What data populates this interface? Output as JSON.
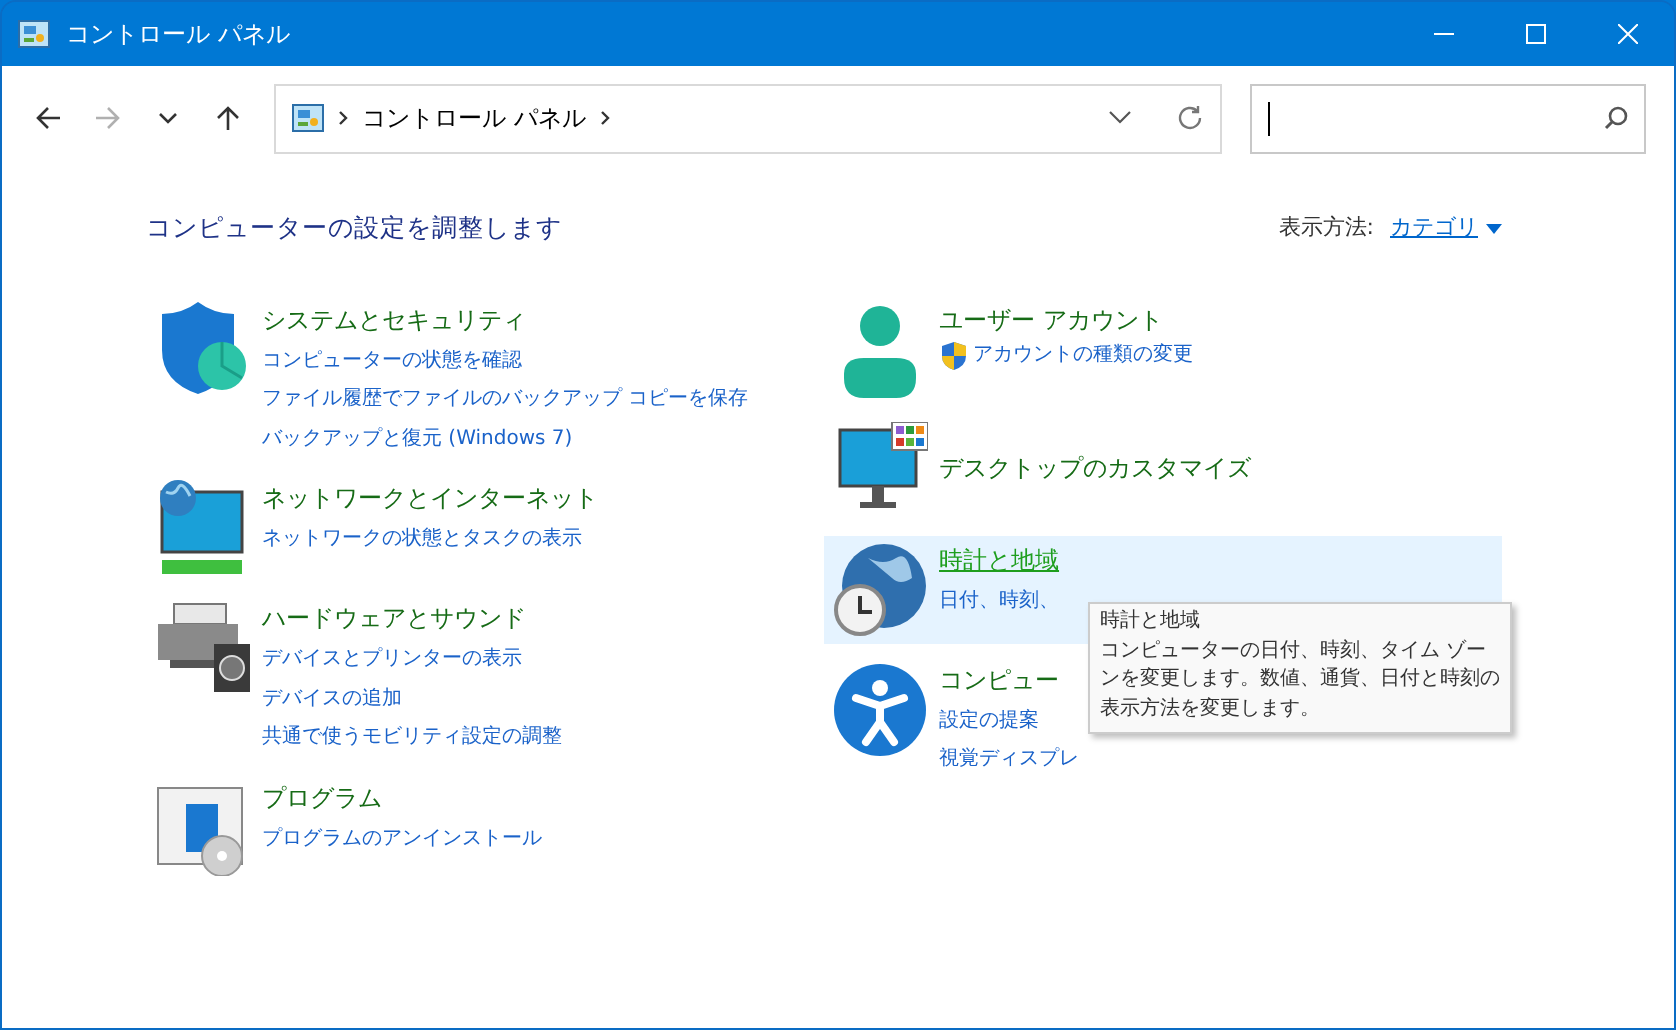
{
  "window": {
    "title": "コントロール パネル"
  },
  "nav_buttons": [
    {
      "kind": "back",
      "disabled": false
    },
    {
      "kind": "forward",
      "disabled": true
    },
    {
      "kind": "recent",
      "disabled": false
    },
    {
      "kind": "up",
      "disabled": false
    }
  ],
  "address_bar": {
    "breadcrumb": "コントロール パネル"
  },
  "search": {
    "focused": true
  },
  "heading": "コンピューターの設定を調整します",
  "view_by": {
    "label": "表示方法:",
    "value": "カテゴリ"
  },
  "columns": [
    {
      "categories": [
        {
          "title": "システムとセキュリティ",
          "hovered": false,
          "links": [
            {
              "text": "コンピューターの状態を確認",
              "shield": false
            },
            {
              "text": "ファイル履歴でファイルのバックアップ コピーを保存",
              "shield": false
            },
            {
              "text": "バックアップと復元 (Windows 7)",
              "shield": false
            }
          ]
        },
        {
          "title": "ネットワークとインターネット",
          "hovered": false,
          "links": [
            {
              "text": "ネットワークの状態とタスクの表示",
              "shield": false
            }
          ]
        },
        {
          "title": "ハードウェアとサウンド",
          "hovered": false,
          "links": [
            {
              "text": "デバイスとプリンターの表示",
              "shield": false
            },
            {
              "text": "デバイスの追加",
              "shield": false
            },
            {
              "text": "共通で使うモビリティ設定の調整",
              "shield": false
            }
          ]
        },
        {
          "title": "プログラム",
          "hovered": false,
          "links": [
            {
              "text": "プログラムのアンインストール",
              "shield": false
            }
          ]
        }
      ]
    },
    {
      "categories": [
        {
          "title": "ユーザー アカウント",
          "hovered": false,
          "links": [
            {
              "text": "アカウントの種類の変更",
              "shield": true
            }
          ]
        },
        {
          "title": "デスクトップのカスタマイズ",
          "hovered": false
        },
        {
          "title": "時計と地域",
          "hovered": true,
          "links": [
            {
              "text": "日付、時刻、",
              "shield": false
            }
          ]
        },
        {
          "title": "コンピュー",
          "hovered": false,
          "links": [
            {
              "text": "設定の提案",
              "shield": false
            },
            {
              "text": "視覚ディスプレ",
              "shield": false
            }
          ]
        }
      ]
    }
  ],
  "tooltip": {
    "title": "時計と地域",
    "text": "コンピューターの日付、時刻、タイム ゾーンを変更します。数値、通貨、日付と時刻の表示方法を変更します。"
  }
}
